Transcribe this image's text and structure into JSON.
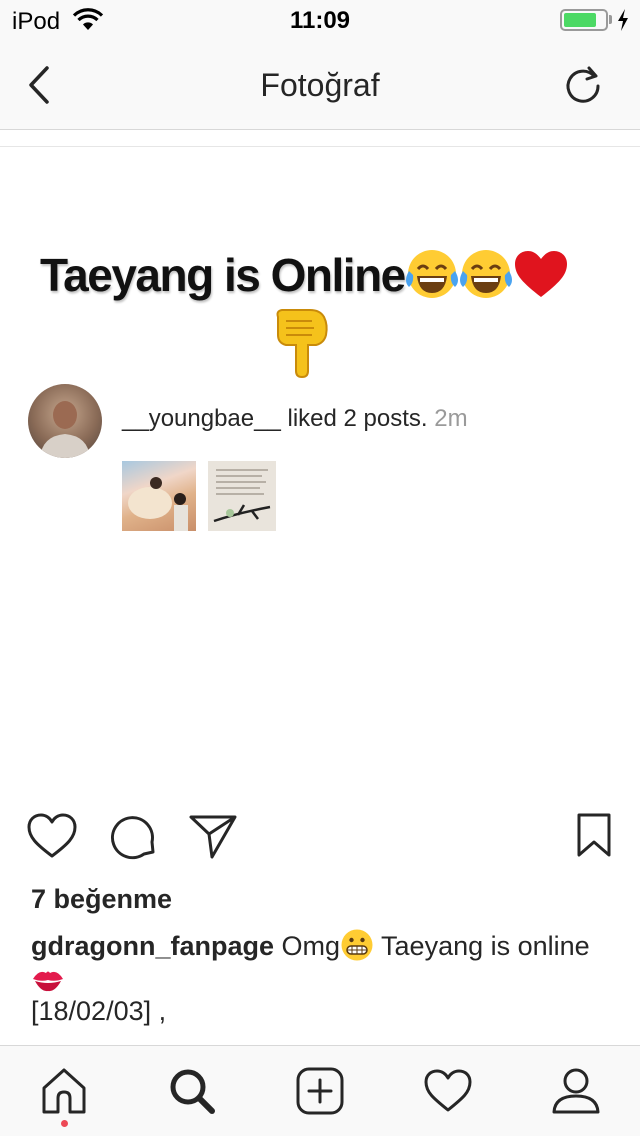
{
  "status_bar": {
    "carrier": "iPod",
    "time": "11:09",
    "battery_level": 0.8,
    "battery_color": "#4cd964"
  },
  "nav": {
    "title": "Fotoğraf",
    "back_icon": "chevron-left-icon",
    "refresh_icon": "refresh-icon"
  },
  "post_image": {
    "headline": "Taeyang is Online",
    "headline_emojis": [
      "tears-of-joy-emoji",
      "tears-of-joy-emoji",
      "red-heart-emoji"
    ],
    "pointer_emoji": "pointing-down-emoji",
    "notification": {
      "username": "__youngbae__",
      "action": " liked 2 posts. ",
      "time": "2m"
    }
  },
  "actions": {
    "like_icon": "heart-icon",
    "comment_icon": "comment-icon",
    "share_icon": "paper-plane-icon",
    "save_icon": "bookmark-icon"
  },
  "likes": "7 beğenme",
  "caption": {
    "username": "gdragonn_fanpage",
    "text_before_emoji": " Omg",
    "emoji": "grimacing-face-emoji",
    "text_after_emoji": " Taeyang is online",
    "trailing_emoji": "kiss-mark-emoji",
    "date_line": "[18/02/03] ,"
  },
  "tab_bar": {
    "items": [
      "home-icon",
      "search-icon",
      "add-icon",
      "activity-heart-icon",
      "profile-icon"
    ],
    "active_dot_color": "#ed4956"
  }
}
